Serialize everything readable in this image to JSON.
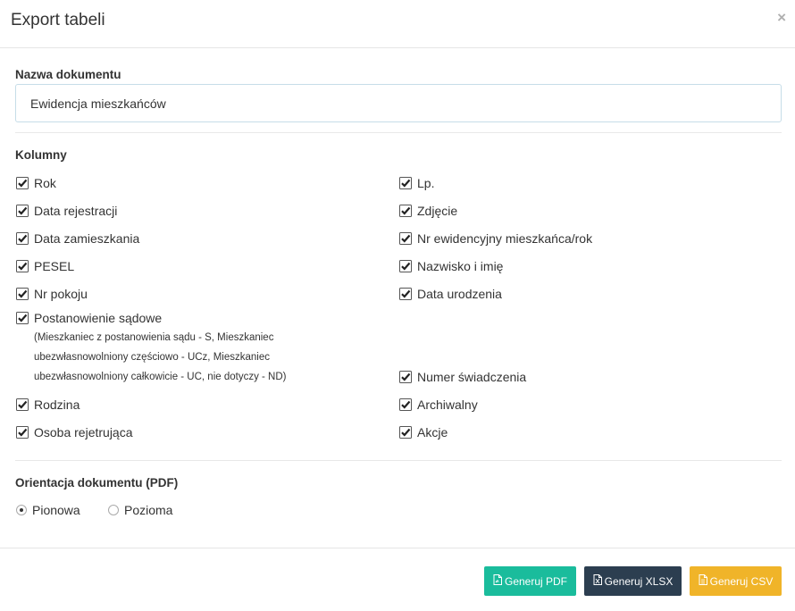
{
  "modal": {
    "title": "Export tabeli",
    "close_symbol": "×"
  },
  "document_name": {
    "label": "Nazwa dokumentu",
    "value": "Ewidencja mieszkańców"
  },
  "columns": {
    "label": "Kolumny",
    "left": [
      {
        "label": "Rok",
        "checked": true
      },
      {
        "label": "Data rejestracji",
        "checked": true
      },
      {
        "label": "Data zamieszkania",
        "checked": true
      },
      {
        "label": "PESEL",
        "checked": true
      },
      {
        "label": "Nr pokoju",
        "checked": true
      },
      {
        "label": "Postanowienie sądowe",
        "note": "(Mieszkaniec z postanowienia sądu - S, Mieszkaniec ubezwłasnowolniony częściowo - UCz, Mieszkaniec ubezwłasnowolniony całkowicie - UC, nie dotyczy - ND)",
        "checked": true
      },
      {
        "label": "Rodzina",
        "checked": true
      },
      {
        "label": "Osoba rejetrująca",
        "checked": true
      }
    ],
    "right": [
      {
        "label": "Lp.",
        "checked": true
      },
      {
        "label": "Zdjęcie",
        "checked": true
      },
      {
        "label": "Nr ewidencyjny mieszkańca/rok",
        "checked": true
      },
      {
        "label": "Nazwisko i imię",
        "checked": true
      },
      {
        "label": "Data urodzenia",
        "checked": true
      },
      {
        "label": "Numer świadczenia",
        "checked": true
      },
      {
        "label": "Archiwalny",
        "checked": true
      },
      {
        "label": "Akcje",
        "checked": true
      }
    ]
  },
  "orientation": {
    "label": "Orientacja dokumentu (PDF)",
    "options": [
      {
        "label": "Pionowa",
        "selected": true
      },
      {
        "label": "Pozioma",
        "selected": false
      }
    ]
  },
  "buttons": {
    "pdf": {
      "label": "Generuj PDF",
      "color": "#1abc9c",
      "icon": "file-pdf-icon"
    },
    "xlsx": {
      "label": "Generuj XLSX",
      "color": "#2c3e50",
      "icon": "file-excel-icon"
    },
    "csv": {
      "label": "Generuj CSV",
      "color": "#f0b429",
      "icon": "file-csv-icon"
    }
  }
}
